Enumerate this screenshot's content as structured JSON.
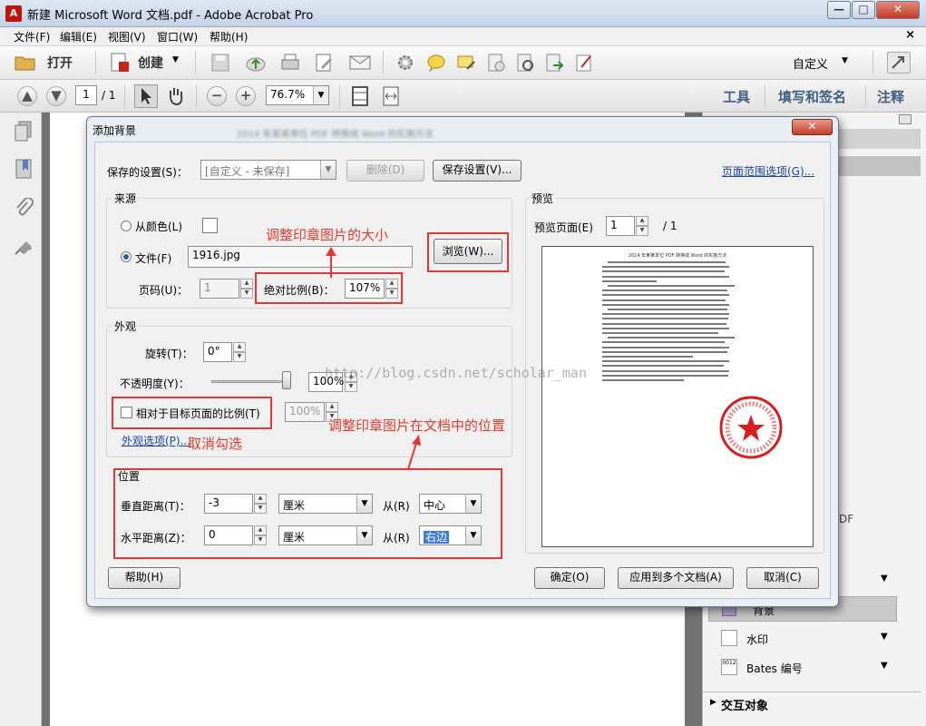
{
  "window": {
    "title": "新建 Microsoft Word 文档.pdf - Adobe Acrobat Pro",
    "close_doc": "×",
    "min": "—",
    "max": "□",
    "close": "✕"
  },
  "menu": [
    "文件(F)",
    "编辑(E)",
    "视图(V)",
    "窗口(W)",
    "帮助(H)"
  ],
  "toolbar": {
    "open_label": "打开",
    "create_label": "创建",
    "customize_label": "自定义"
  },
  "nav": {
    "page_current": "1",
    "page_total": "/ 1",
    "zoom": "76.7%",
    "tools_label": "工具",
    "fill_sign_label": "填写和签名",
    "comment_label": "注释"
  },
  "dialog": {
    "title": "添加背景",
    "blurred_caption": "2014 年某某单位 PDF 转换成 Word 的实施方法",
    "saved_settings_label": "保存的设置(S)：",
    "saved_settings_value": "[自定义 - 未保存]",
    "delete_label": "删除(D)",
    "save_settings_label": "保存设置(V)...",
    "page_range_link": "页面范围选项(G)...",
    "source": {
      "group_title": "来源",
      "from_color_label": "从颜色(L)",
      "file_label": "文件(F)",
      "file_value": "1916.jpg",
      "browse_label": "浏览(W)...",
      "page_num_label": "页码(U)：",
      "page_num_value": "1",
      "abs_scale_label": "绝对比例(B)：",
      "abs_scale_value": "107%"
    },
    "appearance": {
      "group_title": "外观",
      "rotation_label": "旋转(T)：",
      "rotation_value": "0°",
      "opacity_label": "不透明度(Y)：",
      "opacity_value": "100%",
      "relative_scale_label": "相对于目标页面的比例(T)",
      "relative_scale_value": "100%",
      "appearance_options_link": "外观选项(P)..."
    },
    "position": {
      "group_title": "位置",
      "vertical_label": "垂直距离(T)：",
      "vertical_value": "-3",
      "vertical_unit": "厘米",
      "vertical_from_label": "从(R)",
      "vertical_from_value": "中心",
      "horizontal_label": "水平距离(Z)：",
      "horizontal_value": "0",
      "horizontal_unit": "厘米",
      "horizontal_from_label": "从(R)",
      "horizontal_from_value": "右边"
    },
    "preview": {
      "group_title": "预览",
      "preview_page_label": "预览页面(E)",
      "preview_page_value": "1",
      "preview_page_total": "/ 1",
      "doc_title": "2014 年某某单位 PDF 转换成 Word 的实施方法"
    },
    "help_label": "帮助(H)",
    "ok_label": "确定(O)",
    "apply_multi_label": "应用到多个文档(A)",
    "cancel_label": "取消(C)"
  },
  "annotations": {
    "resize": "调整印章图片的大小",
    "position": "调整印章图片在文档中的位置",
    "uncheck": "取消勾选"
  },
  "watermark": "http://blog.csdn.net/scholar_man",
  "right_panel": {
    "background_label": "背景",
    "watermark_label": "水印",
    "bates_label": "Bates 编号",
    "interactive_label": "交互对象",
    "pdf_fragment": "DF"
  },
  "colors": {
    "annotation_red": "#e23737",
    "link_blue": "#1a43a8",
    "stamp_red": "#d81e1e"
  }
}
